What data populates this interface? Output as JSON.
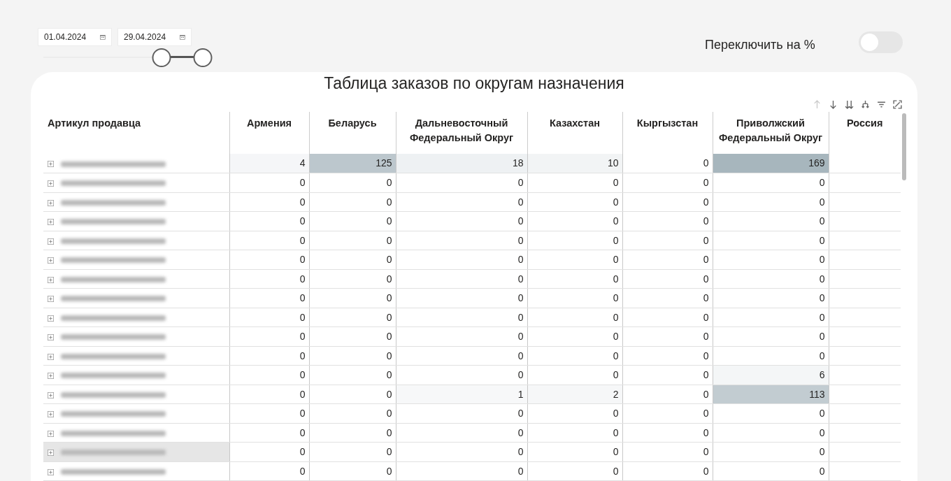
{
  "date_range": {
    "start": "01.04.2024",
    "end": "29.04.2024",
    "thumbs": [
      {
        "level": 0.71
      },
      {
        "level": 0.96
      }
    ]
  },
  "percent_toggle": {
    "label": "Переключить на %",
    "on": false
  },
  "table": {
    "title": "Таблица заказов по округам назначения",
    "toolbar": [
      {
        "kind": "up",
        "disabled": true
      },
      {
        "kind": "down",
        "disabled": false
      },
      {
        "kind": "down2",
        "disabled": false
      },
      {
        "kind": "expand",
        "disabled": false
      },
      {
        "kind": "filter",
        "disabled": false
      },
      {
        "kind": "focus",
        "disabled": false
      }
    ],
    "columns": [
      "Артикул продавца",
      "Армения",
      "Беларусь",
      "Дальневосточный Федеральный Округ",
      "Казахстан",
      "Кыргызстан",
      "Приволжский Федеральный Округ",
      "Россия"
    ],
    "rows": [
      {
        "selected": false,
        "values": [
          "4",
          "125",
          "18",
          "10",
          "0",
          "169"
        ]
      },
      {
        "selected": false,
        "values": [
          "0",
          "0",
          "0",
          "0",
          "0",
          "0"
        ]
      },
      {
        "selected": false,
        "values": [
          "0",
          "0",
          "0",
          "0",
          "0",
          "0"
        ]
      },
      {
        "selected": false,
        "values": [
          "0",
          "0",
          "0",
          "0",
          "0",
          "0"
        ]
      },
      {
        "selected": false,
        "values": [
          "0",
          "0",
          "0",
          "0",
          "0",
          "0"
        ]
      },
      {
        "selected": false,
        "values": [
          "0",
          "0",
          "0",
          "0",
          "0",
          "0"
        ]
      },
      {
        "selected": false,
        "values": [
          "0",
          "0",
          "0",
          "0",
          "0",
          "0"
        ]
      },
      {
        "selected": false,
        "values": [
          "0",
          "0",
          "0",
          "0",
          "0",
          "0"
        ]
      },
      {
        "selected": false,
        "values": [
          "0",
          "0",
          "0",
          "0",
          "0",
          "0"
        ]
      },
      {
        "selected": false,
        "values": [
          "0",
          "0",
          "0",
          "0",
          "0",
          "0"
        ]
      },
      {
        "selected": false,
        "values": [
          "0",
          "0",
          "0",
          "0",
          "0",
          "0"
        ]
      },
      {
        "selected": false,
        "values": [
          "0",
          "0",
          "0",
          "0",
          "0",
          "6"
        ]
      },
      {
        "selected": false,
        "values": [
          "0",
          "0",
          "1",
          "2",
          "0",
          "113"
        ]
      },
      {
        "selected": false,
        "values": [
          "0",
          "0",
          "0",
          "0",
          "0",
          "0"
        ]
      },
      {
        "selected": false,
        "values": [
          "0",
          "0",
          "0",
          "0",
          "0",
          "0"
        ]
      },
      {
        "selected": true,
        "values": [
          "0",
          "0",
          "0",
          "0",
          "0",
          "0"
        ]
      },
      {
        "selected": false,
        "values": [
          "0",
          "0",
          "0",
          "0",
          "0",
          "0"
        ]
      }
    ]
  }
}
